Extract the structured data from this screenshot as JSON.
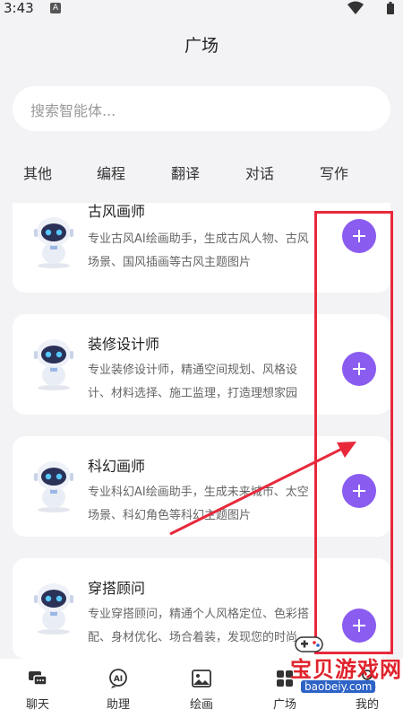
{
  "status_bar": {
    "time": "3:43",
    "notification_letter": "A"
  },
  "header": {
    "title": "广场"
  },
  "search": {
    "placeholder": "搜索智能体..."
  },
  "tabs": [
    {
      "label": "其他"
    },
    {
      "label": "编程"
    },
    {
      "label": "翻译"
    },
    {
      "label": "对话"
    },
    {
      "label": "写作"
    }
  ],
  "cards": [
    {
      "title": "古风画师",
      "desc_lines": [
        "专业古风AI绘画助手，生成古风人物、古风",
        "场景、国风插画等古风主题图片"
      ]
    },
    {
      "title": "装修设计师",
      "desc_lines": [
        "专业装修设计师，精通空间规划、风格设",
        "计、材料选择、施工监理，打造理想家园"
      ]
    },
    {
      "title": "科幻画师",
      "desc_lines": [
        "专业科幻AI绘画助手，生成未来城市、太空",
        "场景、科幻角色等科幻主题图片"
      ]
    },
    {
      "title": "穿搭顾问",
      "desc_lines": [
        "专业穿搭顾问，精通个人风格定位、色彩搭",
        "配、身材优化、场合着装，发现您的时尚"
      ]
    }
  ],
  "bottom_nav": [
    {
      "label": "聊天",
      "icon": "chat-icon"
    },
    {
      "label": "助理",
      "icon": "ai-assistant-icon"
    },
    {
      "label": "绘画",
      "icon": "image-icon"
    },
    {
      "label": "广场",
      "icon": "plaza-icon"
    },
    {
      "label": "我的",
      "icon": "profile-icon"
    }
  ],
  "watermark": {
    "main": "宝贝游戏网",
    "sub": "baobeiy.com"
  },
  "colors": {
    "accent": "#8a5cf0",
    "highlight": "#e8293b",
    "background": "#f3f3f6"
  }
}
